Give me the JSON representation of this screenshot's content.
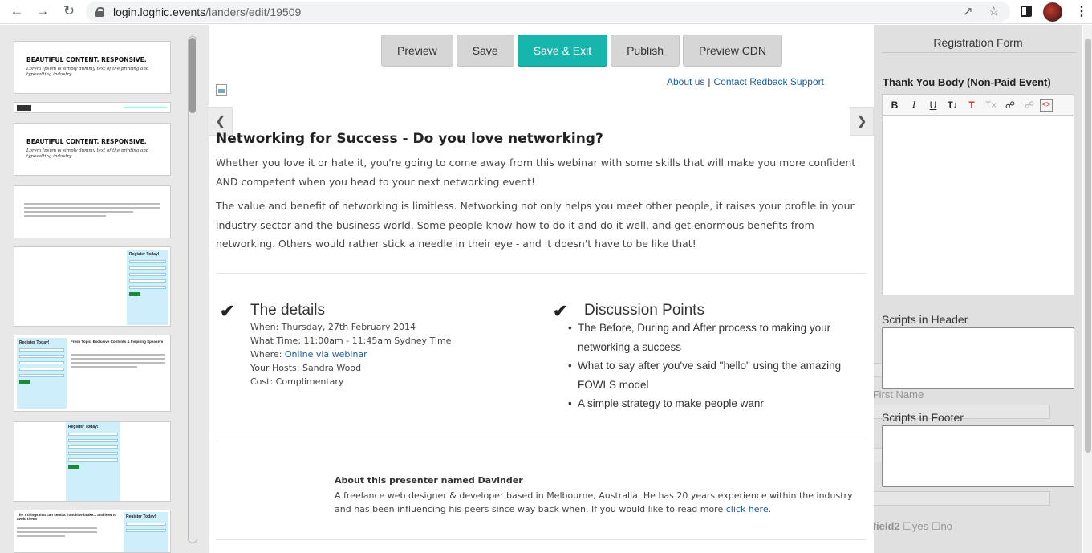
{
  "browser": {
    "url_host": "login.loghic.events",
    "url_path": "/landers/edit/19509"
  },
  "thumbnails": [
    {
      "title": "BEAUTIFUL CONTENT. RESPONSIVE.",
      "subtitle": "Lorem Ipsum is simply dummy text of the printing and typesetting industry."
    },
    {
      "title": "BEAUTIFUL CONTENT. RESPONSIVE.",
      "subtitle": "Lorem Ipsum is simply dummy text of the printing and typesetting industry."
    },
    {
      "form_title": "Register Today!"
    },
    {
      "form_title": "Register Today!",
      "side_title": "Fresh Topic, Exclusive Contents & Inspiring Speakers"
    },
    {
      "form_title": "Register Today!"
    },
    {
      "title": "The 7 things that can send a franchise broke... and how to avoid them!",
      "form_title": "Register Today!"
    }
  ],
  "toolbar": {
    "preview": "Preview",
    "save": "Save",
    "save_exit": "Save & Exit",
    "publish": "Publish",
    "preview_cdn": "Preview CDN"
  },
  "page": {
    "links": {
      "about": "About us",
      "sep": "|",
      "contact": "Contact Redback Support"
    },
    "headline": "Networking for Success - Do you love networking?",
    "para1": "Whether you love it or hate it, you're going to come away from this webinar with some skills that will make you more confident AND competent when you head to your next networking event!",
    "para2": "The value and benefit of networking is limitless. Networking not only helps you meet other people, it raises your profile in your industry sector and the business world. Some people know how to do it and do it well, and get enormous benefits from networking. Others would rather stick a needle in their eye - and it doesn't have to be like that!",
    "details_title": "The details",
    "details": {
      "when": "When: Thursday, 27th February 2014",
      "time": "What Time: 11:00am - 11:45am Sydney Time",
      "where_label": "Where: ",
      "where_link": "Online via webinar",
      "hosts": "Your Hosts: Sandra Wood",
      "cost": "Cost: Complimentary"
    },
    "points_title": "Discussion Points",
    "points": [
      "The Before, During and After process to making your networking a success",
      "What to say after you've said \"hello\" using the amazing FOWLS model",
      "A simple strategy to make people wanr"
    ],
    "presenter_title": "About this presenter named Davinder",
    "presenter_text": "A freelance web designer & developer based in Melbourne, Australia. He has 20 years experience within the industry and has been influencing his peers since way back when.  If you would like to read more ",
    "presenter_link": "click here."
  },
  "right_panel": {
    "title": "Registration Form",
    "thank_you_label": "Thank You Body (Non-Paid Event)",
    "scripts_header": "Scripts in Header",
    "scripts_footer": "Scripts in Footer",
    "bg_fields": {
      "first_name": "First Name",
      "field2": "field2",
      "yes": "yes",
      "no": "no"
    }
  },
  "colors": {
    "primary_button": "#17b6ad",
    "link": "#1a5c9c"
  }
}
